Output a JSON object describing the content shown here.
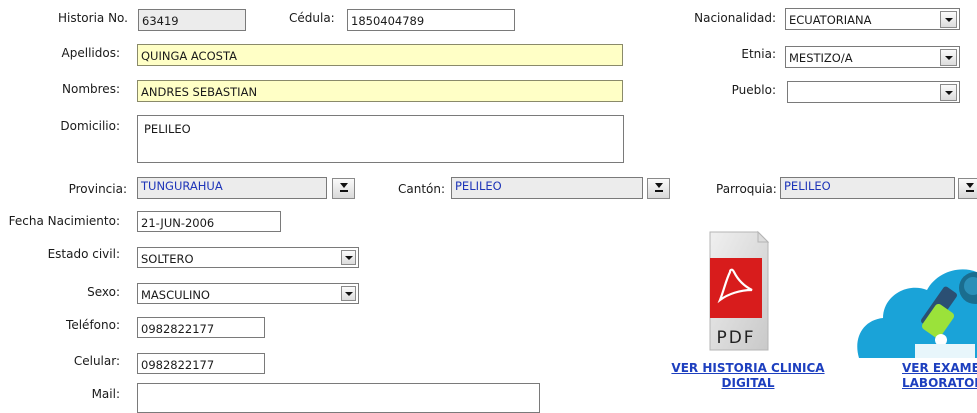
{
  "labels": {
    "historia": "Historia No.",
    "cedula": "Cédula:",
    "nacionalidad": "Nacionalidad:",
    "apellidos": "Apellidos:",
    "etnia": "Etnia:",
    "nombres": "Nombres:",
    "pueblo": "Pueblo:",
    "domicilio": "Domicilio:",
    "provincia": "Provincia:",
    "canton": "Cantón:",
    "parroquia": "Parroquia:",
    "fecha_nacimiento": "Fecha Nacimiento:",
    "estado_civil": "Estado civil:",
    "sexo": "Sexo:",
    "telefono": "Teléfono:",
    "celular": "Celular:",
    "mail": "Mail:"
  },
  "values": {
    "historia": "63419",
    "cedula": "1850404789",
    "nacionalidad": "ECUATORIANA",
    "apellidos": "QUINGA ACOSTA",
    "etnia": "MESTIZO/A",
    "nombres": "ANDRES SEBASTIAN",
    "pueblo": "",
    "domicilio": "PELILEO",
    "provincia": "TUNGURAHUA",
    "canton": "PELILEO",
    "parroquia": "PELILEO",
    "fecha_nacimiento": "21-JUN-2006",
    "estado_civil": "SOLTERO",
    "sexo": "MASCULINO",
    "telefono": "0982822177",
    "celular": "0982822177",
    "mail": ""
  },
  "links": {
    "historia_line1": "VER HISTORIA CLINICA",
    "historia_line2": "DIGITAL",
    "examenes_line1": "VER EXAMENES",
    "examenes_line2": "LABORATORIO"
  },
  "icons": {
    "pdf_text": "PDF",
    "pdf_color": "#d81c1c",
    "lab_cloud_color": "#1aa3d8"
  }
}
